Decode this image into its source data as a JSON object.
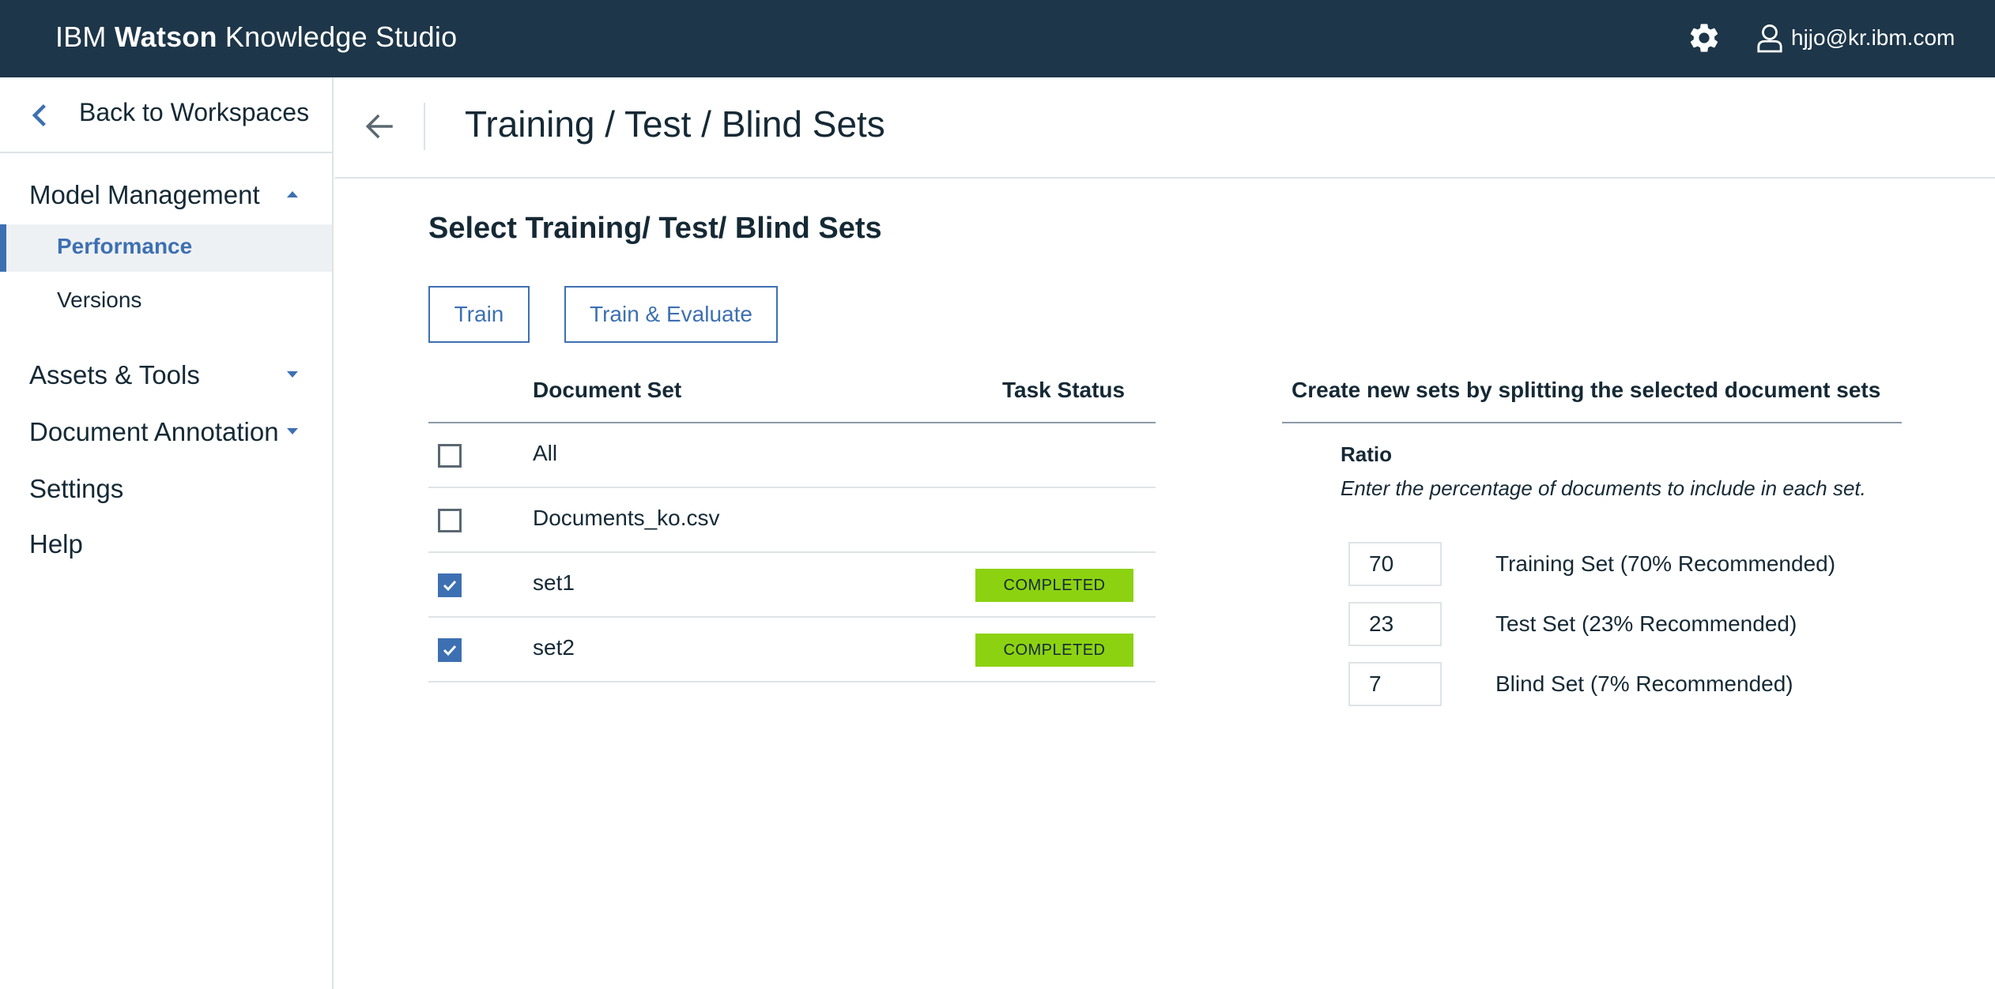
{
  "header": {
    "brand_prefix": "IBM ",
    "brand_bold": "Watson",
    "brand_suffix": " Knowledge Studio",
    "user_email": "hjjo@kr.ibm.com"
  },
  "sidebar": {
    "back_label": "Back to Workspaces",
    "model_management": "Model Management",
    "performance": "Performance",
    "versions": "Versions",
    "assets_tools": "Assets & Tools",
    "document_annotation": "Document Annotation",
    "settings": "Settings",
    "help": "Help"
  },
  "page": {
    "title": "Training / Test / Blind Sets",
    "section_title": "Select Training/ Test/ Blind Sets",
    "train_button": "Train",
    "train_evaluate_button": "Train & Evaluate"
  },
  "table": {
    "headers": {
      "document_set": "Document Set",
      "task_status": "Task Status"
    },
    "rows": [
      {
        "name": "All",
        "checked": false,
        "status": ""
      },
      {
        "name": "Documents_ko.csv",
        "checked": false,
        "status": ""
      },
      {
        "name": "set1",
        "checked": true,
        "status": "COMPLETED"
      },
      {
        "name": "set2",
        "checked": true,
        "status": "COMPLETED"
      }
    ]
  },
  "split": {
    "title": "Create new sets by splitting the selected document sets",
    "ratio_label": "Ratio",
    "ratio_help": "Enter the percentage of documents to include in each set.",
    "training": {
      "value": "70",
      "label": "Training Set  (70% Recommended)"
    },
    "test": {
      "value": "23",
      "label": "Test Set  (23% Recommended)"
    },
    "blind": {
      "value": "7",
      "label": "Blind Set  (7% Recommended)"
    }
  },
  "colors": {
    "header_bg": "#1d3649",
    "accent": "#3d70b2",
    "completed_badge": "#8cd211"
  },
  "icons": {
    "settings": "gear-icon",
    "user": "user-icon",
    "back": "chevron-left-icon",
    "page_back": "arrow-left-icon",
    "expand": "caret-down-icon",
    "collapse": "caret-up-icon"
  }
}
